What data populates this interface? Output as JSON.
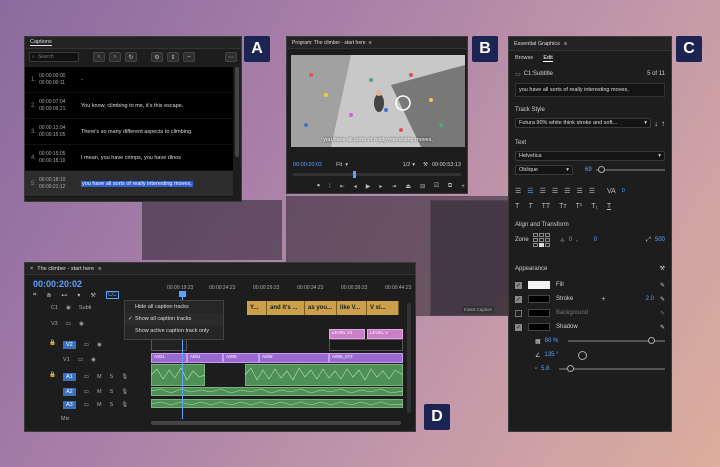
{
  "labels": {
    "a": "A",
    "b": "B",
    "c": "C",
    "d": "D"
  },
  "captions": {
    "title": "Captions",
    "search_placeholder": "Search",
    "rows": [
      {
        "idx": "1.",
        "in": "00:00:00:00",
        "out": "00:00:00:11",
        "text": "-"
      },
      {
        "idx": "2.",
        "in": "00:00:07:04",
        "out": "00:00:09:21",
        "text": "You know, climbing to me, it's this escape."
      },
      {
        "idx": "3.",
        "in": "00:00:13:04",
        "out": "00:00:15:05",
        "text": "There's so many different aspects to climbing."
      },
      {
        "idx": "4.",
        "in": "00:00:15:05",
        "out": "00:00:18:10",
        "text": "I mean, you have crimps, you have dinos"
      },
      {
        "idx": "5.",
        "in": "00:00:18:10",
        "out": "00:00:21:12",
        "text": "you have all sorts of really interesting moves,"
      }
    ]
  },
  "program": {
    "title": "Program: The climber - start here",
    "timecode": "00:00:20:02",
    "zoom": "Fit",
    "quality": "1/2",
    "duration": "00:00:53:13",
    "video_caption": "you have all sorts of really interesting moves,"
  },
  "graphics": {
    "title": "Essential Graphics",
    "tabs": [
      "Browse",
      "Edit"
    ],
    "item_name": "C1:Subtitle",
    "item_count": "5 of 11",
    "caption_text": "you have all sorts of really interesting moves,",
    "track_style_label": "Track Style",
    "track_style_value": "Futura 90% white think stroke and soft...",
    "text_label": "Text",
    "font": "Helvetica",
    "font_style": "Oblique",
    "font_size": "69",
    "tracking": "0",
    "align_label": "Align and Transform",
    "zone_label": "Zone",
    "pos_x": "0",
    "pos_y": "0",
    "pos_size": "500",
    "appearance_label": "Appearance",
    "fill_label": "Fill",
    "stroke_label": "Stroke",
    "stroke_width": "2.0",
    "background_label": "Background",
    "shadow_label": "Shadow",
    "opacity": "80 %",
    "angle": "135 °",
    "distance": "5.8"
  },
  "timeline": {
    "title": "The climber - start here",
    "timecode": "00:00:20:02",
    "ruler": [
      "00:00:19:23",
      "00:00:24:23",
      "00:00:29:23",
      "00:00:34:23",
      "00:00:39:23",
      "00:00:44:23"
    ],
    "caption_clips": [
      "Y...",
      "and it's ...",
      "as you...",
      "like V...",
      "V si..."
    ],
    "tracks": [
      "C1",
      "V3",
      "V2",
      "V1",
      "A1",
      "A2",
      "A3"
    ],
    "track_subtitle": "Subti",
    "level_labels": [
      "LEVEL V1",
      "LEVEL V"
    ],
    "clip_labels": [
      "A001",
      "A001",
      "A005",
      "A005",
      "A005_073"
    ],
    "context_menu": [
      "Hide all caption tracks",
      "Show all caption tracks",
      "Show active caption track only"
    ],
    "mini_label": "Mix",
    "m_label": "M",
    "s_label": "S"
  },
  "bg_window": {
    "label": "Insert Caption"
  }
}
